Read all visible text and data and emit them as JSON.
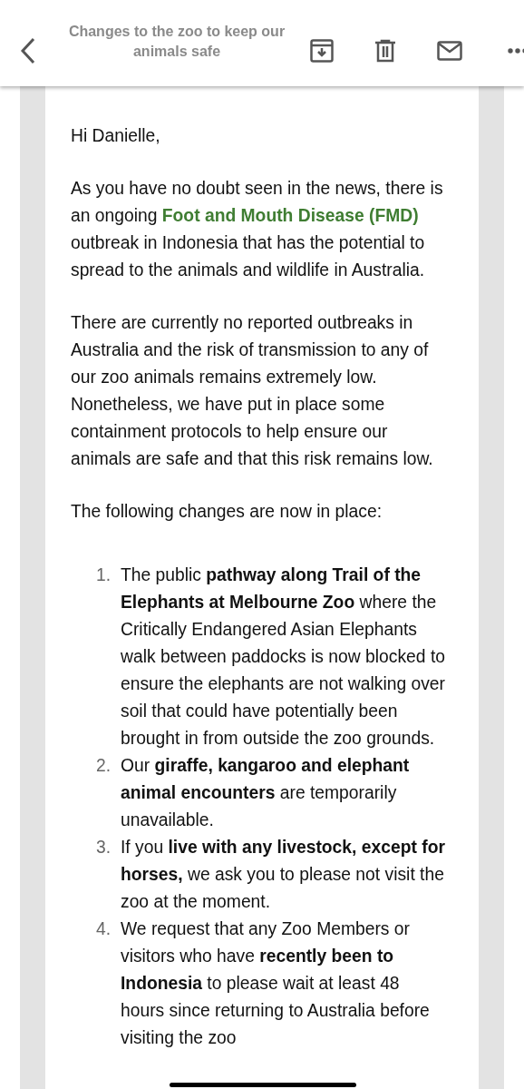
{
  "header": {
    "title": "Changes to the zoo to keep our animals safe"
  },
  "email": {
    "greeting": "Hi Danielle,",
    "intro": {
      "before": "As you have no doubt seen in the news, there is an ongoing",
      "link": "Foot and Mouth Disease (FMD)",
      "after": "outbreak in Indonesia that has the potential to spread to the animals and wildlife in Australia."
    },
    "paragraphs": [
      "There are currently no reported outbreaks in Australia and the risk of transmission to any of our zoo animals remains extremely low. Nonetheless, we have put in place some containment protocols to help ensure our animals are safe and that this risk remains low.",
      "The following changes are now in place:"
    ],
    "changes": [
      {
        "number": "1.",
        "text": "The public **pathway along Trail of the Elephants at Melbourne Zoo** where the Critically Endangered Asian Elephants walk between paddocks is now blocked to ensure the elephants are not walking over soil that could have potentially been brought in from outside the zoo grounds."
      },
      {
        "number": "2.",
        "text": "Our **giraffe, kangaroo and elephant animal encounters** are temporarily unavailable."
      },
      {
        "number": "3.",
        "text": "If you **live with any livestock, except for horses,** we ask you to please not visit the zoo at the moment."
      },
      {
        "number": "4.",
        "text": "We request that any Zoo Members or visitors who have **recently been to Indonesia** to please wait at least 48 hours since returning to Australia before visiting the zoo"
      }
    ]
  }
}
